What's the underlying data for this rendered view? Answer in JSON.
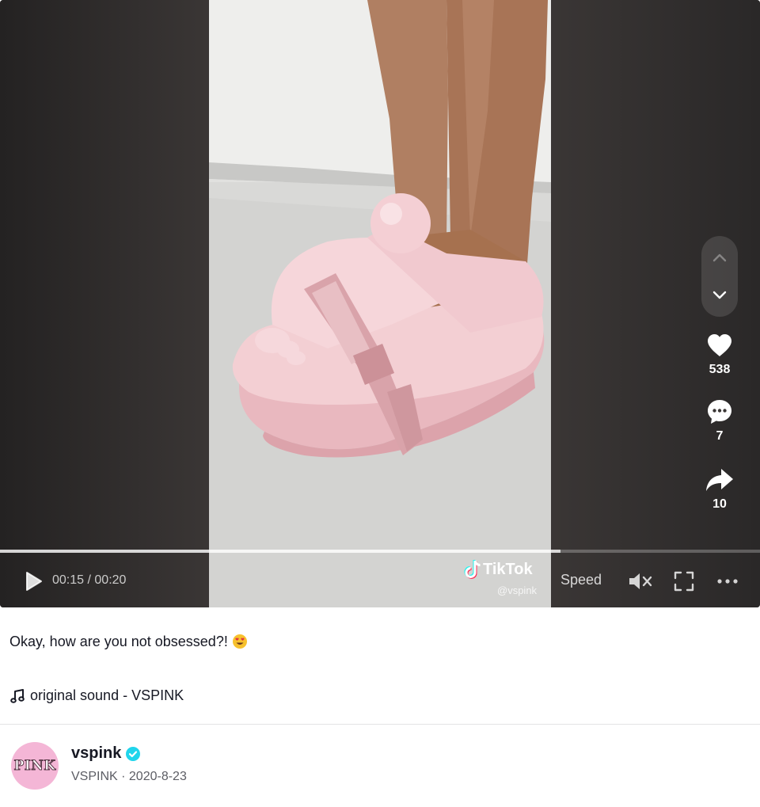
{
  "player": {
    "time_current": "00:15",
    "time_total": "00:20",
    "time_separator": " / ",
    "progress": 0.738,
    "watermark_brand": "TikTok",
    "watermark_handle": "@vspink",
    "speed_label": "Speed",
    "muted": true
  },
  "actions": {
    "likes": "538",
    "comments": "7",
    "shares": "10"
  },
  "post": {
    "caption": "Okay, how are you not obsessed?!",
    "caption_emoji": "heart-eyes-emoji",
    "music": "original sound - VSPINK"
  },
  "author": {
    "avatar_text": "PINK",
    "username": "vspink",
    "verified": true,
    "nickname": "VSPINK",
    "date": "2020-8-23",
    "meta_separator": " · "
  },
  "colors": {
    "verified_blue": "#20d5ec",
    "avatar_pink": "#f4b6d6",
    "text_primary": "#161823",
    "text_secondary": "#5c5d64"
  }
}
